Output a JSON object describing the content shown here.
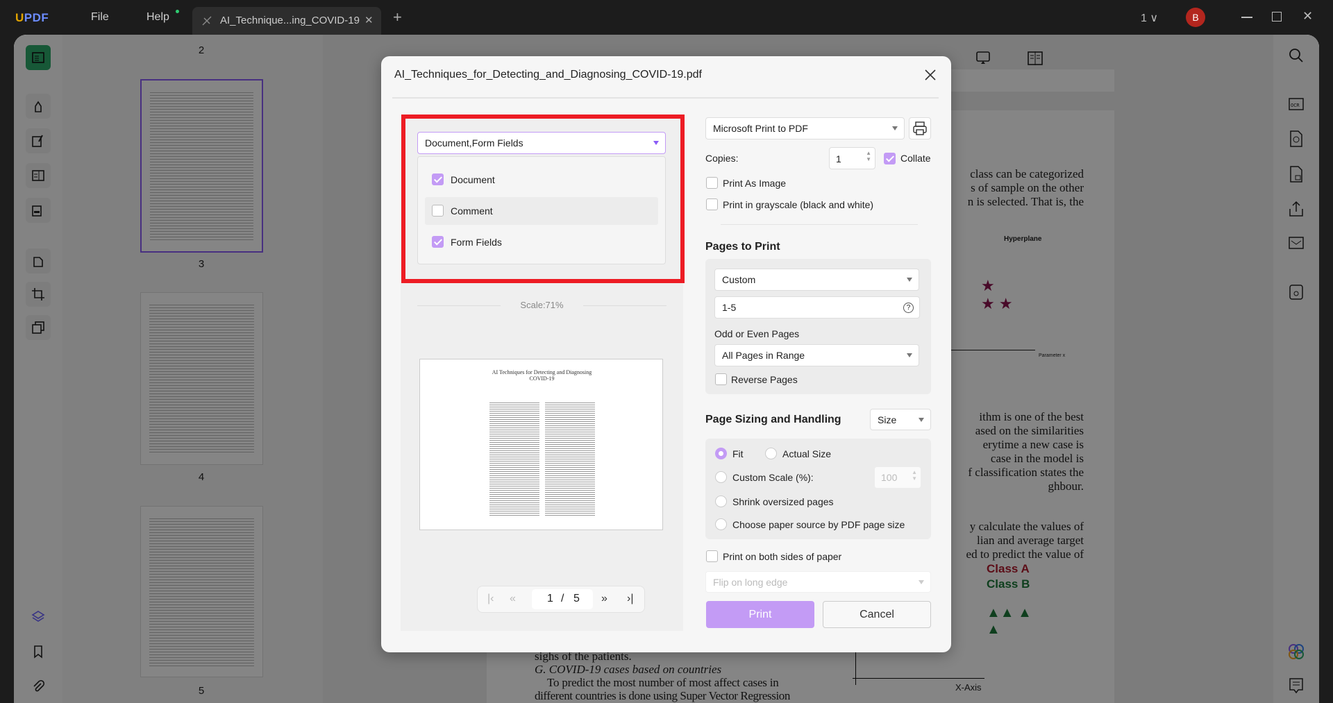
{
  "titlebar": {
    "logo": "UPDF",
    "menu": [
      "File",
      "Help"
    ],
    "tab_title": "AI_Technique...ing_COVID-19",
    "new_tab": "+",
    "page_count": "1 ∨",
    "avatar": "B",
    "colors": {
      "logo_u": "#e2a400",
      "logo_p": "#6c63ff",
      "avatar": "#b3261e"
    }
  },
  "thumbnails": {
    "labels": [
      "2",
      "3",
      "4",
      "5"
    ]
  },
  "document": {
    "right_text": [
      "class can be categorized",
      "s of sample on the other",
      "n is selected. That is, the"
    ],
    "hyperplane": "Hyperplane",
    "parameter": "Parameter x",
    "right_text2": [
      "ithm is one of the best",
      "ased on the similarities",
      "erytime a new case is",
      "case in the model is",
      "f classification states the",
      "ghbour."
    ],
    "right_text3": [
      "y calculate the values of",
      "lian and average target",
      "ed to predict the value of"
    ],
    "legend": [
      "Class A",
      "Class B"
    ],
    "legend_colors": [
      "#b01c2e",
      "#1d7a3a"
    ],
    "xaxis": "X-Axis",
    "bottom_text": [
      "sighs of the patients.",
      "G. COVID-19 cases based on countries",
      "To predict the most number of most affect cases in",
      "different countries is done using Super Vector Regression"
    ]
  },
  "dialog": {
    "title": "AI_Techniques_for_Detecting_and_Diagnosing_COVID-19.pdf",
    "content_select": "Document,Form Fields",
    "content_options": [
      {
        "label": "Document",
        "checked": true
      },
      {
        "label": "Comment",
        "checked": false
      },
      {
        "label": "Form Fields",
        "checked": true
      }
    ],
    "scale": "Scale:71%",
    "preview": {
      "title_line1": "AI Techniques for Detecting and Diagnosing",
      "title_line2": "COVID-19"
    },
    "pager": {
      "current": "1",
      "sep": "/",
      "total": "5"
    },
    "printer": "Microsoft Print to PDF",
    "copies_label": "Copies:",
    "copies": "1",
    "collate": {
      "label": "Collate",
      "checked": true
    },
    "print_as_image": {
      "label": "Print As Image",
      "checked": false
    },
    "grayscale": {
      "label": "Print in grayscale (black and white)",
      "checked": false
    },
    "pages_heading": "Pages to Print",
    "pages_mode": "Custom",
    "page_range": "1-5",
    "odd_even_label": "Odd or Even Pages",
    "odd_even": "All Pages in Range",
    "reverse": {
      "label": "Reverse Pages",
      "checked": false
    },
    "sizing_heading": "Page Sizing and Handling",
    "sizing_mode": "Size",
    "sizing_options": {
      "fit": "Fit",
      "actual": "Actual Size",
      "custom": "Custom Scale (%):",
      "shrink": "Shrink oversized pages",
      "choose": "Choose paper source by PDF page size"
    },
    "sizing_selected": "Fit",
    "custom_scale": "100",
    "both_sides": {
      "label": "Print on both sides of paper",
      "checked": false
    },
    "flip": "Flip on long edge",
    "print_button": "Print",
    "cancel_button": "Cancel",
    "colors": {
      "accent": "#c39bf5",
      "highlight": "#ed1c24"
    }
  }
}
